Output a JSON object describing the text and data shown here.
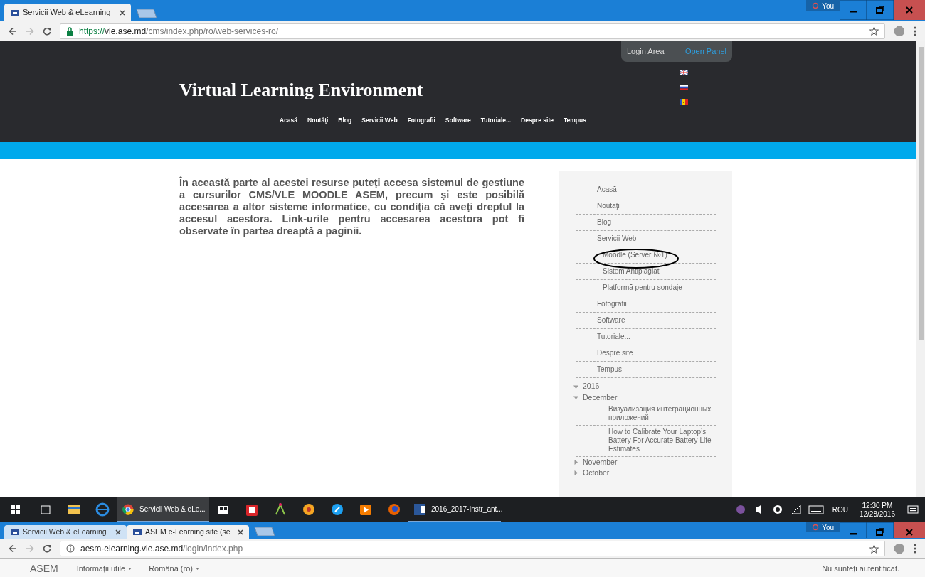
{
  "top_browser": {
    "tabs": [
      {
        "title": "Servicii Web & eLearning",
        "selected": true
      }
    ],
    "profile": "You",
    "url": {
      "scheme": "https://",
      "host": "vle.ase.md",
      "path": "/cms/index.php/ro/web-services-ro/"
    }
  },
  "site": {
    "login_area": "Login Area",
    "open_panel": "Open Panel",
    "title": "Virtual Learning Environment",
    "nav": [
      "Acasă",
      "Noutăţi",
      "Blog",
      "Servicii Web",
      "Fotografii",
      "Software",
      "Tutoriale...",
      "Despre site",
      "Tempus"
    ],
    "intro": "În această parte al acestei resurse puteți accesa sistemul de gestiune a cursurilor CMS/VLE MOODLE ASEM, precum și este posibilă accesarea a altor sisteme informatice, cu condiția că aveți dreptul la accesul acestora. Link-urile pentru accesarea acestora pot fi observate în partea dreaptă a paginii.",
    "menu": [
      {
        "label": "Acasă"
      },
      {
        "label": "Noutăţi"
      },
      {
        "label": "Blog"
      },
      {
        "label": "Servicii Web",
        "children": [
          {
            "label": "Moodle (Server №1)",
            "circled": true
          },
          {
            "label": "Sistem Antiplagiat",
            "circled": false
          },
          {
            "label": "Platformă pentru sondaje",
            "circled": false
          }
        ]
      },
      {
        "label": "Fotografii"
      },
      {
        "label": "Software"
      },
      {
        "label": "Tutoriale..."
      },
      {
        "label": "Despre site"
      },
      {
        "label": "Tempus"
      }
    ],
    "archive": [
      {
        "label": "2016",
        "expanded": true,
        "children": [
          {
            "label": "December",
            "expanded": true,
            "posts": [
              "Визуализация интеграционных приложений",
              "How to Calibrate Your Laptop’s Battery For Accurate Battery Life Estimates"
            ]
          },
          {
            "label": "November",
            "expanded": false
          },
          {
            "label": "October",
            "expanded": false
          }
        ]
      }
    ]
  },
  "taskbar": {
    "windows": [
      {
        "label": "Servicii Web & eLe...",
        "active": true
      },
      {
        "label": "2016_2017-Instr_ant...",
        "active": false
      }
    ],
    "language": "ROU",
    "time": "12:30 PM",
    "date": "12/28/2016"
  },
  "bottom_browser": {
    "tabs": [
      {
        "title": "Servicii Web & eLearning",
        "selected": false
      },
      {
        "title": "ASEM e-Learning site (se",
        "selected": true
      }
    ],
    "profile": "You",
    "url": {
      "host": "aesm-elearning.vle.ase.md",
      "path": "/login/index.php"
    },
    "navbar": {
      "brand": "ASEM",
      "menus": [
        "Informații utile",
        "Română (ro)"
      ],
      "login_status": "Nu sunteți autentificat."
    }
  }
}
